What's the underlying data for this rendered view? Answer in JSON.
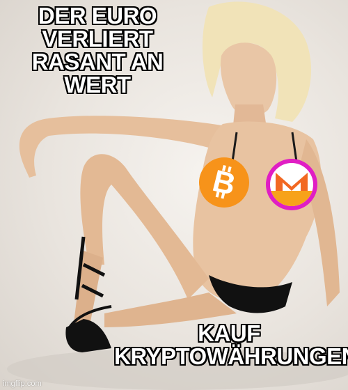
{
  "caption": {
    "top": "DER EURO VERLIERT RASANT AN WERT",
    "bottom": "KAUF KRYPTOWÄHRUNGEN"
  },
  "watermark": "imgflip.com",
  "icons": {
    "left": "bitcoin-logo-icon",
    "right": "monero-logo-icon"
  },
  "colors": {
    "text": "#ffffff",
    "outline": "#000000",
    "bitcoin": "#f7931a",
    "monero_orange": "#f26822",
    "monero_magenta": "#e01ec4",
    "monero_dark": "#4c4c4c"
  }
}
